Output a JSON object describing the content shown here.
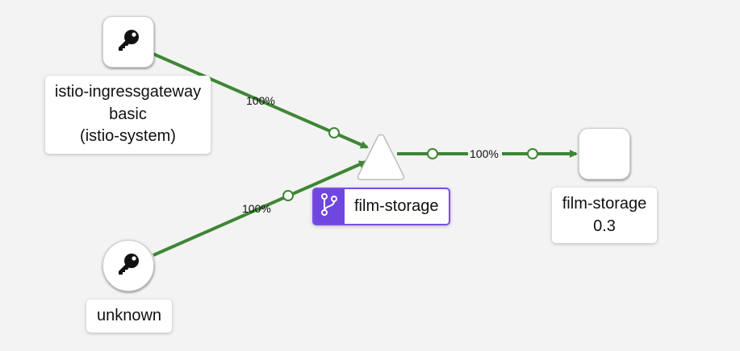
{
  "nodes": {
    "ingress_gateway": {
      "lines": [
        "istio-ingressgateway",
        "basic",
        "(istio-system)"
      ],
      "icon": "key-icon"
    },
    "unknown": {
      "lines": [
        "unknown"
      ],
      "icon": "key-icon"
    },
    "service": {
      "label": "film-storage",
      "icon": "code-branch-icon"
    },
    "workload": {
      "lines": [
        "film-storage",
        "0.3"
      ]
    }
  },
  "edges": {
    "ingress_to_service": "100%",
    "unknown_to_service": "100%",
    "service_to_workload": "100%"
  },
  "colors": {
    "edge": "#3e8635",
    "service_badge": "#6f46e0",
    "service_border": "#7b4fe0",
    "background": "#f3f3f3"
  }
}
